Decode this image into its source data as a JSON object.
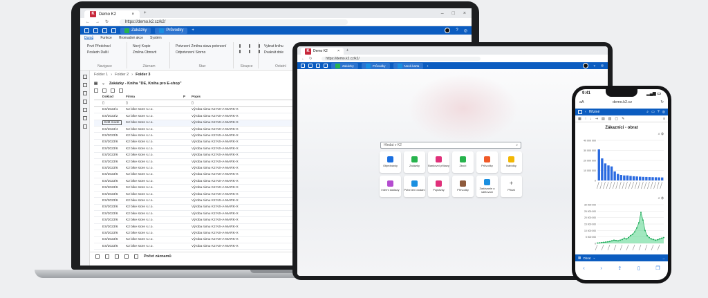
{
  "colors": {
    "accent": "#0b5cc0",
    "brand_red": "#c7283b",
    "chart_bar": "#2a6ae0",
    "chart_area": "#2ecc71"
  },
  "laptop": {
    "browser_tab": "Demo K2",
    "url": "https://demo.k2.cz/k2/",
    "app_tabs": [
      "Zakázky",
      "Průvodky"
    ],
    "ribbon_tabs": [
      "Domů",
      "Funkce",
      "Hromadné akce",
      "Systém"
    ],
    "ribbon_groups": [
      {
        "name": "Navigace",
        "rows": [
          "Prvé   Předchozí",
          "Posledn   Další"
        ]
      },
      {
        "name": "Záznam",
        "rows": [
          "Nový   Kopie",
          "Změna   Obnovit"
        ]
      },
      {
        "name": "Stav",
        "rows": [
          "Potvrzení   Změna stavu potvrzení",
          "Odpotvrzení   Storno"
        ]
      },
      {
        "name": "Sloupce",
        "rows": [
          "",
          ""
        ]
      },
      {
        "name": "Ostatní",
        "rows": [
          "Vybrat knihu",
          "Dvakrát dole"
        ]
      }
    ],
    "breadcrumb": [
      "Folder 1",
      "Folder 2",
      "Folder 3"
    ],
    "grid_title": "Zakázky - Kniha \"DE, Kniha pro E-shop\"",
    "columns": [
      "Doklad",
      "Firma",
      "P",
      "Popis"
    ],
    "rows": [
      {
        "doc": "ES/2023/1",
        "firm": "K2 bike store s.r.o.",
        "desc": "Výroba rámu K2 NX-A-MARK-X"
      },
      {
        "doc": "ES/2023/2",
        "firm": "K2 bike store s.r.o.",
        "desc": "Výroba rámu K2 NX-A-MARK-X"
      },
      {
        "doc": "Edit mode",
        "firm": "K2 bike store s.r.o.",
        "desc": "Výroba rámu K2 NX-A-MARK-X"
      },
      {
        "doc": "ES/2023/4",
        "firm": "K2 bike store s.r.o.",
        "desc": "Výroba rámu K2 NX-A-MARK-X"
      },
      {
        "doc": "ES/2023/5",
        "firm": "K2 bike store s.r.o.",
        "desc": "Výroba rámu K2 NX-A-MARK-X"
      },
      {
        "doc": "ES/2023/6",
        "firm": "K2 bike store s.r.o.",
        "desc": "Výroba rámu K2 NX-A-MARK-X"
      },
      {
        "doc": "ES/2023/6",
        "firm": "K2 bike store s.r.o.",
        "desc": "Výroba rámu K2 NX-A-MARK-X"
      },
      {
        "doc": "ES/2023/6",
        "firm": "K2 bike store s.r.o.",
        "desc": "Výroba rámu K2 NX-A-MARK-X"
      },
      {
        "doc": "ES/2023/6",
        "firm": "K2 bike store s.r.o.",
        "desc": "Výroba rámu K2 NX-A-MARK-X"
      },
      {
        "doc": "ES/2023/6",
        "firm": "K2 bike store s.r.o.",
        "desc": "Výroba rámu K2 NX-A-MARK-X"
      },
      {
        "doc": "ES/2023/6",
        "firm": "K2 bike store s.r.o.",
        "desc": "Výroba rámu K2 NX-A-MARK-X"
      },
      {
        "doc": "ES/2023/6",
        "firm": "K2 bike store s.r.o.",
        "desc": "Výroba rámu K2 NX-A-MARK-X"
      },
      {
        "doc": "ES/2023/6",
        "firm": "K2 bike store s.r.o.",
        "desc": "Výroba rámu K2 NX-A-MARK-X"
      },
      {
        "doc": "ES/2023/6",
        "firm": "K2 bike store s.r.o.",
        "desc": "Výroba rámu K2 NX-A-MARK-X"
      },
      {
        "doc": "ES/2023/6",
        "firm": "K2 bike store s.r.o.",
        "desc": "Výroba rámu K2 NX-A-MARK-X"
      },
      {
        "doc": "ES/2023/6",
        "firm": "K2 bike store s.r.o.",
        "desc": "Výroba rámu K2 NX-A-MARK-X"
      },
      {
        "doc": "ES/2023/6",
        "firm": "K2 bike store s.r.o.",
        "desc": "Výroba rámu K2 NX-A-MARK-X"
      },
      {
        "doc": "ES/2023/6",
        "firm": "K2 bike store s.r.o.",
        "desc": "Výroba rámu K2 NX-A-MARK-X"
      },
      {
        "doc": "ES/2023/6",
        "firm": "K2 bike store s.r.o.",
        "desc": "Výroba rámu K2 NX-A-MARK-X"
      },
      {
        "doc": "ES/2023/6",
        "firm": "K2 bike store s.r.o.",
        "desc": "Výroba rámu K2 NX-A-MARK-X"
      },
      {
        "doc": "ES/2023/6",
        "firm": "K2 bike store s.r.o.",
        "desc": "Výroba rámu K2 NX-A-MARK-X"
      },
      {
        "doc": "ES/2023/6",
        "firm": "K2 bike store s.r.o.",
        "desc": "Výroba rámu K2 NX-A-MARK-X"
      }
    ],
    "footer_label": "Počet záznamů"
  },
  "tablet": {
    "browser_tab": "Demo K2",
    "url": "https://demo.k2.cz/k2/",
    "app_tabs": [
      "Zakázky",
      "Průvodky",
      "Nová karta"
    ],
    "search_placeholder": "Hledat v K2",
    "tiles": [
      {
        "label": "Objednávky",
        "color": "#1a6fe0"
      },
      {
        "label": "Zakázky",
        "color": "#27b34d"
      },
      {
        "label": "Bankovní příkazy",
        "color": "#e0307a"
      },
      {
        "label": "Zboží",
        "color": "#27b34d"
      },
      {
        "label": "Průvodky",
        "color": "#f05a28"
      },
      {
        "label": "Nabídky",
        "color": "#f2b705"
      },
      {
        "label": "Interní doklady",
        "color": "#b44ccf"
      },
      {
        "label": "Potvrzení dodání",
        "color": "#1a8fe0"
      },
      {
        "label": "Poptávky",
        "color": "#e0307a"
      },
      {
        "label": "Převodky",
        "color": "#8e5a3c"
      },
      {
        "label": "Zadávanie a sdělování",
        "color": "#1a8fe0"
      },
      {
        "label": "Přidat",
        "color": ""
      }
    ]
  },
  "phone": {
    "time": "9:41",
    "url": "demo.k2.cz",
    "aa": "aA",
    "appbar_label": "Hřiziné",
    "title": "Zákazníci - obrat",
    "footer_label": "Obrat",
    "chart_data": [
      {
        "type": "bar",
        "categories": [
          "A",
          "B",
          "C",
          "D",
          "E",
          "F",
          "G",
          "H",
          "I",
          "J",
          "K",
          "L",
          "M",
          "N",
          "O",
          "P",
          "Q",
          "R",
          "S",
          "T",
          "U"
        ],
        "values": [
          31000000,
          22000000,
          17000000,
          15000000,
          14000000,
          9000000,
          6500000,
          5500000,
          5000000,
          5000000,
          4500000,
          4200000,
          4000000,
          3800000,
          3600000,
          3500000,
          3400000,
          3300000,
          3200000,
          3100000,
          3000000
        ],
        "yticks": [
          "40 000 000",
          "30 000 000",
          "20 000 000",
          "10 000 000",
          "0"
        ],
        "ylim": [
          0,
          40000000
        ]
      },
      {
        "type": "area",
        "values": [
          0.3,
          0.4,
          0.6,
          0.8,
          1.0,
          1.2,
          1.5,
          2.0,
          2.5,
          2.2,
          2.0,
          2.5,
          3.0,
          4.0,
          3.5,
          4.5,
          6.0,
          7.0,
          9.0,
          12.0,
          16.0,
          24.0,
          18.0,
          10.0,
          6.0,
          4.5,
          3.5,
          3.0,
          2.5,
          2.8,
          3.5,
          4.0,
          4.5
        ],
        "yticks": [
          "30 000 000",
          "25 000 000",
          "20 000 000",
          "15 000 000",
          "10 000 000",
          "5 000 000",
          "0"
        ],
        "ylim": [
          0,
          30
        ]
      }
    ]
  }
}
